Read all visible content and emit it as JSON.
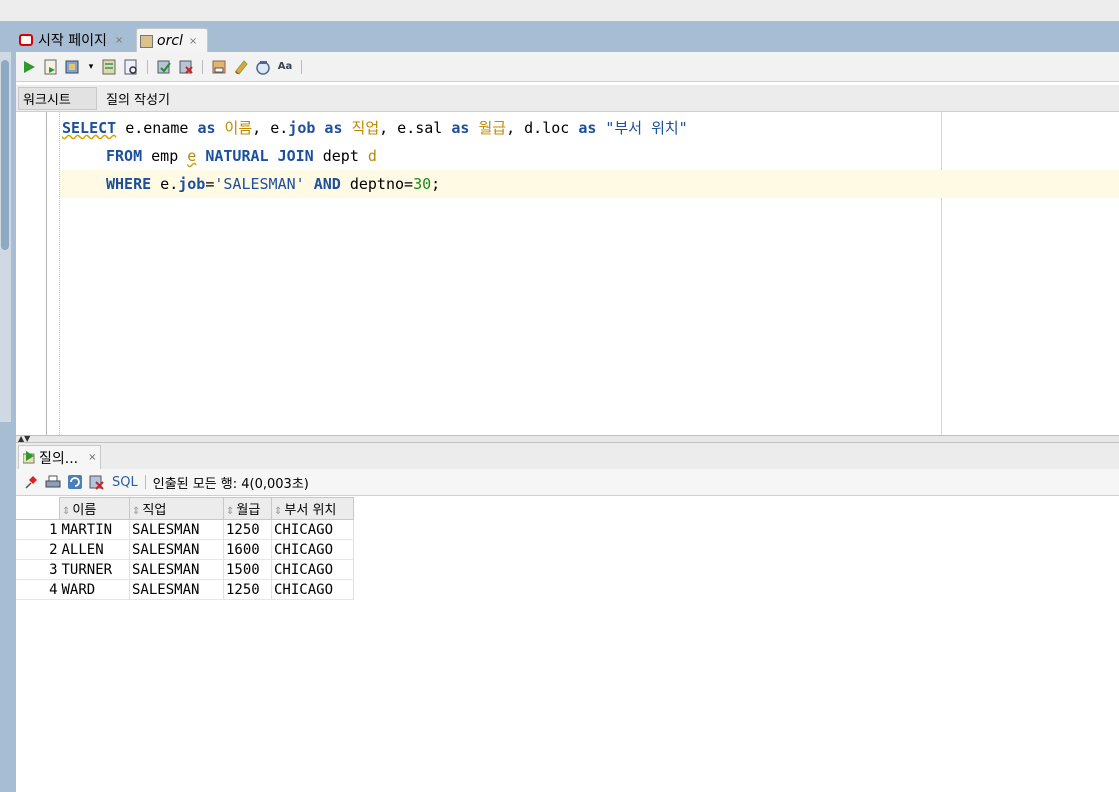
{
  "tabs": [
    {
      "label": "시작 페이지",
      "icon": "oracle-icon",
      "close": "×"
    },
    {
      "label": "orcl",
      "icon": "sql-connection-icon",
      "close": "×"
    }
  ],
  "sub_tabs": {
    "worksheet": "워크시트",
    "query_builder": "질의 작성기"
  },
  "sql": {
    "line1": {
      "kw_select": "SELECT",
      "p1": " e.ename ",
      "as1": "as",
      "a1": " 이름",
      "p2": ", e.",
      "job": "job",
      "p3": " ",
      "as2": "as",
      "a2": " 직업",
      "p4": ", e.sal ",
      "as3": "as",
      "a3": " 월급",
      "p5": ", d.loc ",
      "as4": "as",
      "s1": " \"부서 위치\""
    },
    "line2": {
      "kw_from": "FROM",
      "p1": " emp ",
      "alias_e": "e",
      "p2": " ",
      "kw_natural": "NATURAL JOIN",
      "p3": " dept ",
      "alias_d": "d"
    },
    "line3": {
      "kw_where": "WHERE",
      "p1": " e.",
      "job": "job",
      "p2": "=",
      "s1": "'SALESMAN'",
      "p3": " ",
      "kw_and": "AND",
      "p4": " deptno=",
      "num": "30",
      "p5": ";"
    }
  },
  "result_tab": {
    "label": "질의...",
    "close": "×"
  },
  "result_toolbar": {
    "sql_link": "SQL",
    "status": "인출된 모든 행: 4(0,003초)"
  },
  "grid": {
    "columns": [
      "이름",
      "직업",
      "월급",
      "부서 위치"
    ],
    "rows": [
      {
        "n": "1",
        "c": [
          "MARTIN",
          "SALESMAN",
          "1250",
          "CHICAGO"
        ]
      },
      {
        "n": "2",
        "c": [
          "ALLEN",
          "SALESMAN",
          "1600",
          "CHICAGO"
        ]
      },
      {
        "n": "3",
        "c": [
          "TURNER",
          "SALESMAN",
          "1500",
          "CHICAGO"
        ]
      },
      {
        "n": "4",
        "c": [
          "WARD",
          "SALESMAN",
          "1250",
          "CHICAGO"
        ]
      }
    ]
  },
  "colors": {
    "tab_bar": "#a6bdd4",
    "keyword": "#1c4f9c",
    "korean_text": "#c08a00",
    "number": "#1a8a1a",
    "highlight_line": "#fffae3"
  }
}
